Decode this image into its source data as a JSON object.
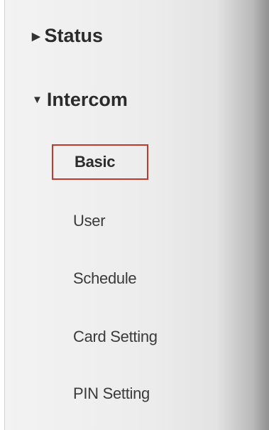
{
  "sidebar": {
    "sections": [
      {
        "label": "Status",
        "arrow": "▶",
        "expanded": false
      },
      {
        "label": "Intercom",
        "arrow": "▼",
        "expanded": true
      }
    ],
    "intercom_items": [
      {
        "label": "Basic",
        "selected": true
      },
      {
        "label": "User"
      },
      {
        "label": "Schedule"
      },
      {
        "label": "Card Setting"
      },
      {
        "label": "PIN Setting"
      }
    ],
    "selected_border_color": "#c0392b"
  }
}
